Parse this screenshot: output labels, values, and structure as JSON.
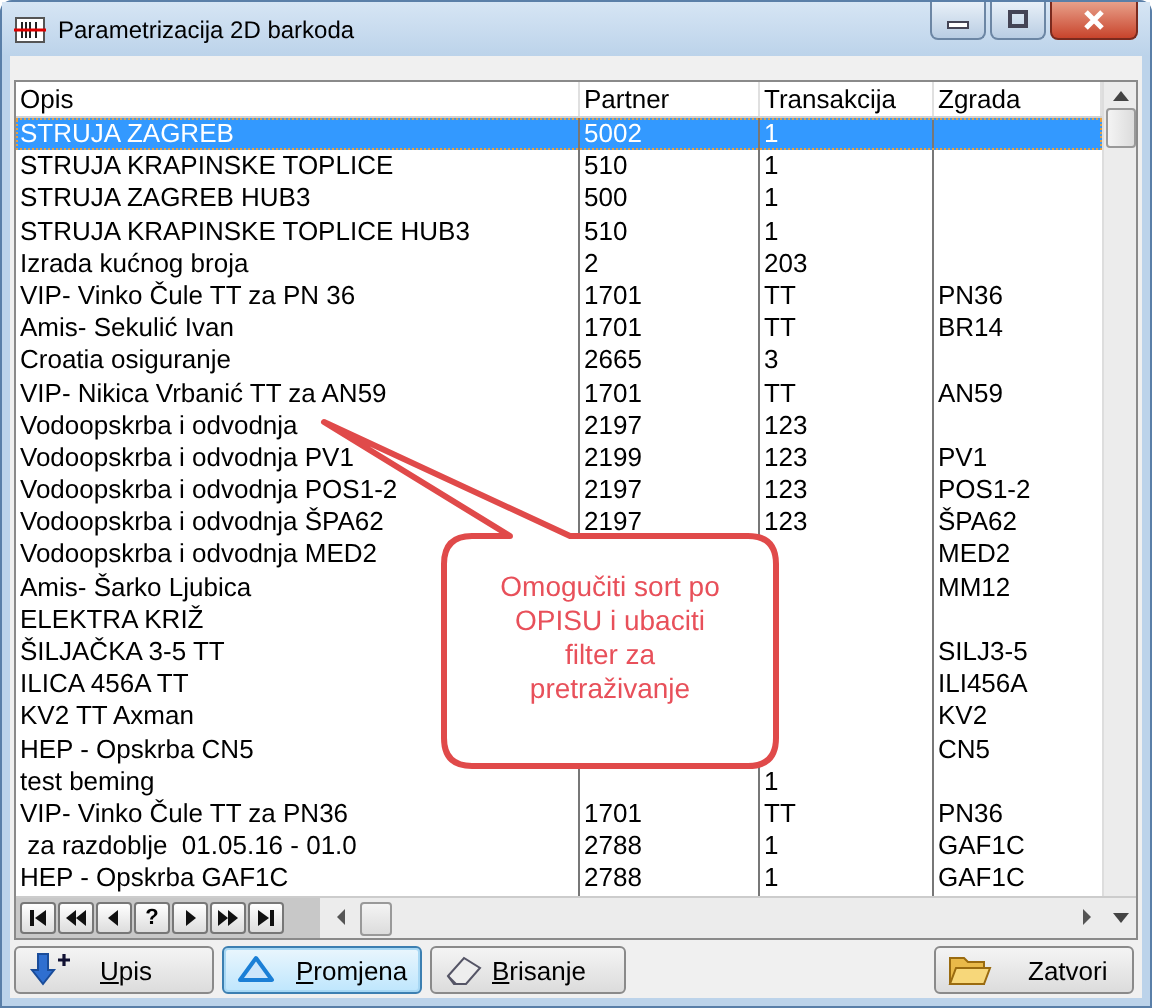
{
  "window": {
    "title": "Parametrizacija 2D barkoda"
  },
  "table": {
    "columns": [
      "Opis",
      "Partner",
      "Transakcija",
      "Zgrada"
    ],
    "rows": [
      {
        "cells": [
          "STRUJA ZAGREB",
          "5002",
          "1",
          null
        ],
        "selected": true
      },
      {
        "cells": [
          "STRUJA KRAPINSKE TOPLICE",
          "510",
          "1",
          null
        ],
        "selected": false
      },
      {
        "cells": [
          "STRUJA ZAGREB HUB3",
          "500",
          "1",
          null
        ],
        "selected": false
      },
      {
        "cells": [
          "STRUJA KRAPINSKE TOPLICE HUB3",
          "510",
          "1",
          null
        ],
        "selected": false
      },
      {
        "cells": [
          "Izrada kućnog broja",
          "2",
          "203",
          null
        ],
        "selected": false
      },
      {
        "cells": [
          "VIP- Vinko Čule TT za PN 36",
          "1701",
          "TT",
          "PN36"
        ],
        "selected": false
      },
      {
        "cells": [
          "Amis- Sekulić Ivan",
          "1701",
          "TT",
          "BR14"
        ],
        "selected": false
      },
      {
        "cells": [
          "Croatia osiguranje",
          "2665",
          "3",
          null
        ],
        "selected": false
      },
      {
        "cells": [
          "VIP- Nikica Vrbanić TT za AN59",
          "1701",
          "TT",
          "AN59"
        ],
        "selected": false
      },
      {
        "cells": [
          "Vodoopskrba i odvodnja",
          "2197",
          "123",
          null
        ],
        "selected": false
      },
      {
        "cells": [
          "Vodoopskrba i odvodnja PV1",
          "2199",
          "123",
          "PV1"
        ],
        "selected": false
      },
      {
        "cells": [
          "Vodoopskrba i odvodnja POS1-2",
          "2197",
          "123",
          "POS1-2"
        ],
        "selected": false
      },
      {
        "cells": [
          "Vodoopskrba i odvodnja ŠPA62",
          "2197",
          "123",
          "ŠPA62"
        ],
        "selected": false
      },
      {
        "cells": [
          "Vodoopskrba i odvodnja MED2",
          null,
          null,
          "MED2"
        ],
        "selected": false
      },
      {
        "cells": [
          "Amis- Šarko Ljubica",
          null,
          null,
          "MM12"
        ],
        "selected": false
      },
      {
        "cells": [
          "ELEKTRA KRIŽ",
          null,
          null,
          null
        ],
        "selected": false
      },
      {
        "cells": [
          "ŠILJAČKA 3-5 TT",
          null,
          null,
          "SILJ3-5"
        ],
        "selected": false
      },
      {
        "cells": [
          "ILICA 456A TT",
          null,
          null,
          "ILI456A"
        ],
        "selected": false
      },
      {
        "cells": [
          "KV2 TT Axman",
          null,
          null,
          "KV2"
        ],
        "selected": false
      },
      {
        "cells": [
          "HEP - Opskrba CN5",
          null,
          null,
          "CN5"
        ],
        "selected": false
      },
      {
        "cells": [
          "test beming",
          null,
          "1",
          null
        ],
        "selected": false
      },
      {
        "cells": [
          "VIP- Vinko Čule TT za PN36",
          "1701",
          "TT",
          "PN36"
        ],
        "selected": false
      },
      {
        "cells": [
          " za razdoblje  01.05.16 - 01.0",
          "2788",
          "1",
          "GAF1C"
        ],
        "selected": false
      },
      {
        "cells": [
          "HEP - Opskrba GAF1C",
          "2788",
          "1",
          "GAF1C"
        ],
        "selected": false
      }
    ]
  },
  "navigator": [
    {
      "kind": "first"
    },
    {
      "kind": "prior-page"
    },
    {
      "kind": "prior"
    },
    {
      "kind": "help",
      "label": "?"
    },
    {
      "kind": "next"
    },
    {
      "kind": "next-page"
    },
    {
      "kind": "last"
    }
  ],
  "callout": {
    "text": "Omogučiti sort po OPISU i ubaciti filter za pretraživanje"
  },
  "buttons": [
    {
      "kind": "add",
      "label": "Upis",
      "underline_first": true,
      "focused": false
    },
    {
      "kind": "edit",
      "label": "Promjena",
      "underline_first": true,
      "focused": true
    },
    {
      "kind": "delete",
      "label": "Brisanje",
      "underline_first": true,
      "focused": false
    },
    {
      "kind": "close",
      "label": "Zatvori",
      "underline_first": false,
      "focused": false
    }
  ]
}
